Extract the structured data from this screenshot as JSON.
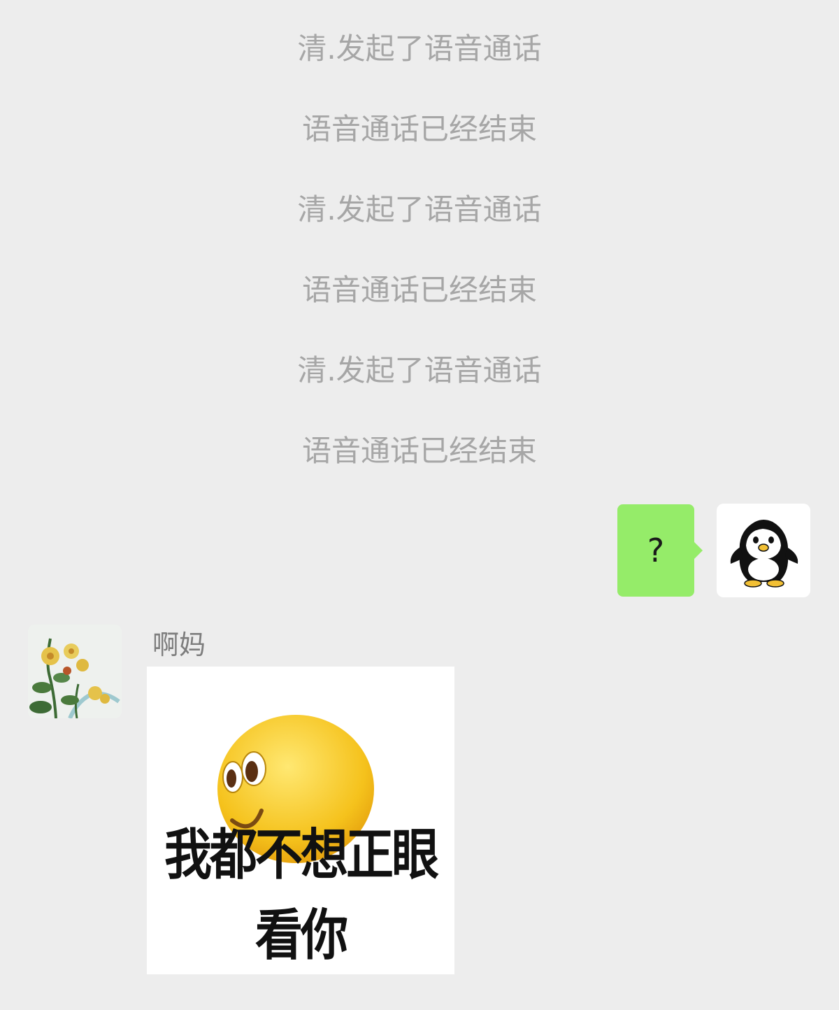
{
  "system_messages": [
    "清.发起了语音通话",
    "语音通话已经结束",
    "清.发起了语音通话",
    "语音通话已经结束",
    "清.发起了语音通话",
    "语音通话已经结束"
  ],
  "my_message": {
    "text": "?",
    "bubble_color": "#95ec69",
    "avatar_icon": "penguin-icon"
  },
  "contact_message": {
    "sender_name": "啊妈",
    "avatar_icon": "chrysanthemum-painting-icon",
    "sticker": {
      "icon": "smirking-emoji-icon",
      "caption": "我都不想正眼看你"
    }
  },
  "colors": {
    "background": "#ededed",
    "system_text": "#a6a6a6",
    "sender_text": "#7d7d7d"
  }
}
